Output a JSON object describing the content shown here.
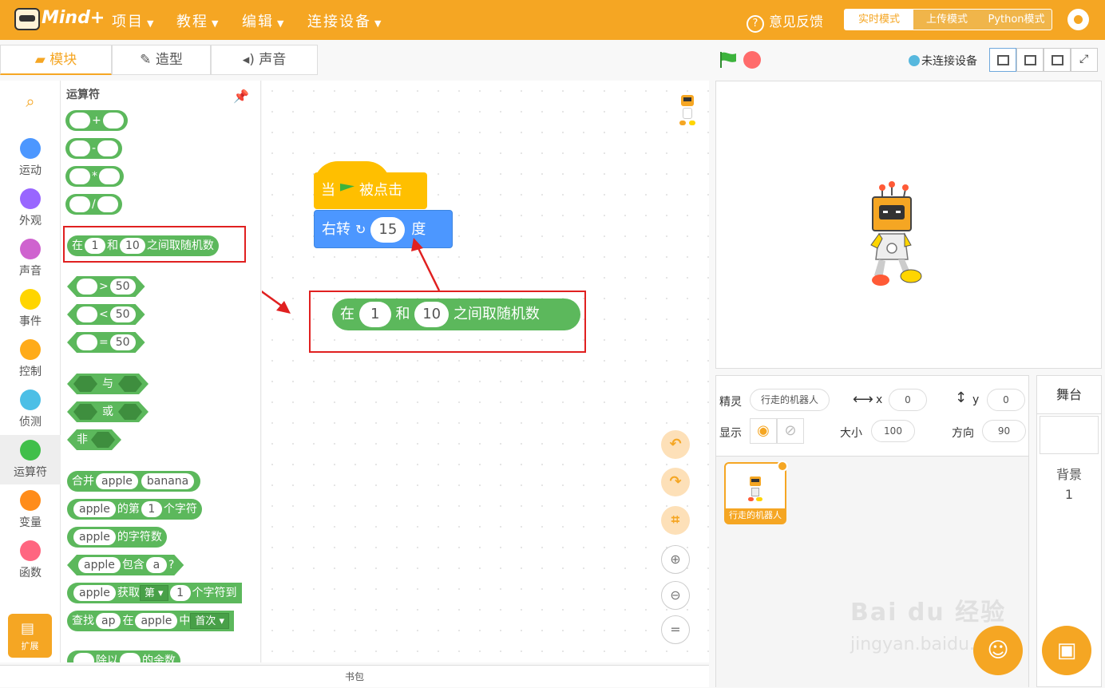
{
  "header": {
    "logo_text": "Mind+",
    "menus": [
      "项目",
      "教程",
      "编辑",
      "连接设备"
    ],
    "feedback": "意见反馈",
    "modes": [
      "实时模式",
      "上传模式",
      "Python模式"
    ],
    "active_mode": "实时模式"
  },
  "tabs": [
    "模块",
    "造型",
    "声音"
  ],
  "stage_controls": {
    "connection_status": "未连接设备"
  },
  "categories": [
    {
      "label": "运动",
      "color": "#4c97ff"
    },
    {
      "label": "外观",
      "color": "#9966ff"
    },
    {
      "label": "声音",
      "color": "#cf63cf"
    },
    {
      "label": "事件",
      "color": "#ffd500"
    },
    {
      "label": "控制",
      "color": "#ffab19"
    },
    {
      "label": "侦测",
      "color": "#4cbfe6"
    },
    {
      "label": "运算符",
      "color": "#40bf4a"
    },
    {
      "label": "变量",
      "color": "#ff8c1a"
    },
    {
      "label": "函数",
      "color": "#ff6680"
    }
  ],
  "extension_label": "扩展",
  "palette": {
    "title": "运算符",
    "ops": [
      "+",
      "-",
      "*",
      "/"
    ],
    "random": {
      "prefix": "在",
      "a": "1",
      "mid": "和",
      "b": "10",
      "suffix": "之间取随机数"
    },
    "compare": [
      {
        "op": ">",
        "val": "50"
      },
      {
        "op": "<",
        "val": "50"
      },
      {
        "op": "=",
        "val": "50"
      }
    ],
    "bool_and": "与",
    "bool_or": "或",
    "bool_not": "非",
    "join": {
      "label": "合并",
      "a": "apple",
      "b": "banana"
    },
    "letter": {
      "a": "apple",
      "mid": "的第",
      "n": "1",
      "suffix": "个字符"
    },
    "length": {
      "a": "apple",
      "suffix": "的字符数"
    },
    "contains": {
      "a": "apple",
      "mid": "包含",
      "b": "a",
      "suffix": "?"
    },
    "substr": {
      "a": "apple",
      "mid": "获取",
      "dd": "第",
      "n": "1",
      "suffix": "个字符到"
    },
    "find": {
      "label": "查找",
      "a": "ap",
      "mid": "在",
      "b": "apple",
      "mid2": "中",
      "dd": "首次"
    },
    "mod": {
      "mid": "除以",
      "suffix": "的余数"
    }
  },
  "workspace": {
    "event_block": {
      "pre": "当",
      "post": "被点击"
    },
    "motion_block": {
      "label": "右转",
      "value": "15",
      "unit": "度"
    },
    "random_block": {
      "prefix": "在",
      "a": "1",
      "mid": "和",
      "b": "10",
      "suffix": "之间取随机数"
    }
  },
  "bookbar_label": "书包",
  "sprite_info": {
    "sprite_label": "精灵",
    "sprite_name": "行走的机器人",
    "x_label": "x",
    "x": "0",
    "y_label": "y",
    "y": "0",
    "show_label": "显示",
    "size_label": "大小",
    "size": "100",
    "direction_label": "方向",
    "direction": "90"
  },
  "sprite_thumb": {
    "name": "行走的机器人"
  },
  "stage_panel": {
    "title": "舞台",
    "backdrop_label": "背景",
    "backdrop_count": "1"
  },
  "watermark": {
    "line1": "Bai du 经验",
    "line2": "jingyan.baidu.com"
  }
}
